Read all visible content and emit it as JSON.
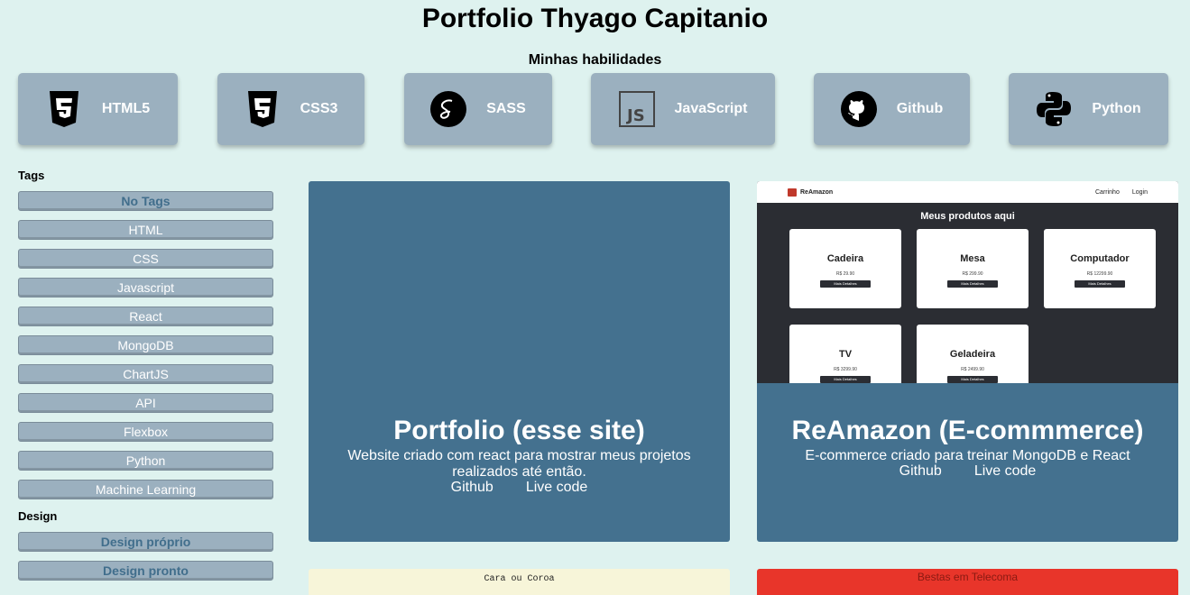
{
  "header": {
    "title": "Portfolio Thyago Capitanio",
    "skills_heading": "Minhas habilidades"
  },
  "skills": [
    {
      "label": "HTML5",
      "icon": "html5-icon"
    },
    {
      "label": "CSS3",
      "icon": "css3-icon"
    },
    {
      "label": "SASS",
      "icon": "sass-icon"
    },
    {
      "label": "JavaScript",
      "icon": "javascript-icon"
    },
    {
      "label": "Github",
      "icon": "github-icon"
    },
    {
      "label": "Python",
      "icon": "python-icon"
    }
  ],
  "sidebar": {
    "tags_heading": "Tags",
    "tags": [
      "No Tags",
      "HTML",
      "CSS",
      "Javascript",
      "React",
      "MongoDB",
      "ChartJS",
      "API",
      "Flexbox",
      "Python",
      "Machine Learning"
    ],
    "design_heading": "Design",
    "design": [
      "Design próprio",
      "Design pronto"
    ]
  },
  "projects": [
    {
      "title": "Portfolio (esse site)",
      "description": "Website criado com react para mostrar meus projetos realizados até então.",
      "github": "Github",
      "live": "Live code"
    },
    {
      "title": "ReAmazon (E-commmerce)",
      "description": "E-commerce criado para treinar MongoDB e React",
      "github": "Github",
      "live": "Live code",
      "screenshot": {
        "brand": "ReAmazon",
        "cart": "Carrinho",
        "login": "Login",
        "heading": "Meus produtos aqui",
        "products": [
          {
            "name": "Cadeira",
            "price": "R$ 29.90",
            "button": "Mais Detalhes"
          },
          {
            "name": "Mesa",
            "price": "R$ 299.90",
            "button": "Mais Detalhes"
          },
          {
            "name": "Computador",
            "price": "R$ 12299.90",
            "button": "Mais Detalhes"
          },
          {
            "name": "TV",
            "price": "R$ 3299.90",
            "button": "Mais Detalhes"
          },
          {
            "name": "Geladeira",
            "price": "R$ 2499.90",
            "button": "Mais Detalhes"
          }
        ]
      }
    },
    {
      "screenshot_label": "Cara ou Coroa"
    },
    {
      "screenshot_label": "Bestas em Telecoma"
    }
  ],
  "colors": {
    "background": "#def2ef",
    "skill_bg": "#9bb0bf",
    "card_bg": "#44718f",
    "accent_text": "#416e8c"
  }
}
